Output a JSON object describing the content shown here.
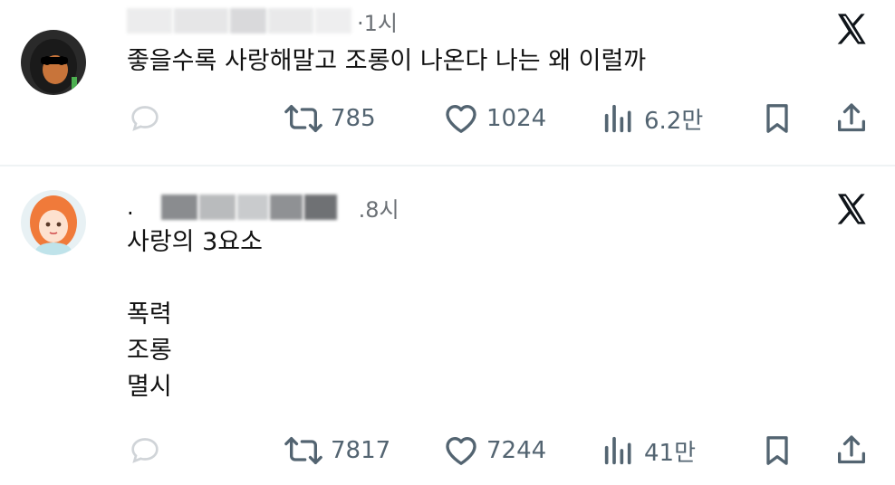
{
  "posts": [
    {
      "time": "·1시",
      "text": "좋을수록 사랑해말고 조롱이 나온다 나는 왜 이럴까",
      "retweets": "785",
      "likes": "1024",
      "views": "6.2만"
    },
    {
      "time": ".8시",
      "text": "사랑의 3요소\n\n폭력\n조롱\n멸시",
      "retweets": "7817",
      "likes": "7244",
      "views": "41만"
    }
  ],
  "icons": {
    "reply": "reply-icon",
    "retweet": "retweet-icon",
    "like": "heart-icon",
    "views": "views-icon",
    "bookmark": "bookmark-icon",
    "share": "share-icon",
    "platform": "x-logo-icon"
  },
  "colors": {
    "icon_gray": "#536471",
    "text": "#111111",
    "divider": "#eff3f4"
  }
}
